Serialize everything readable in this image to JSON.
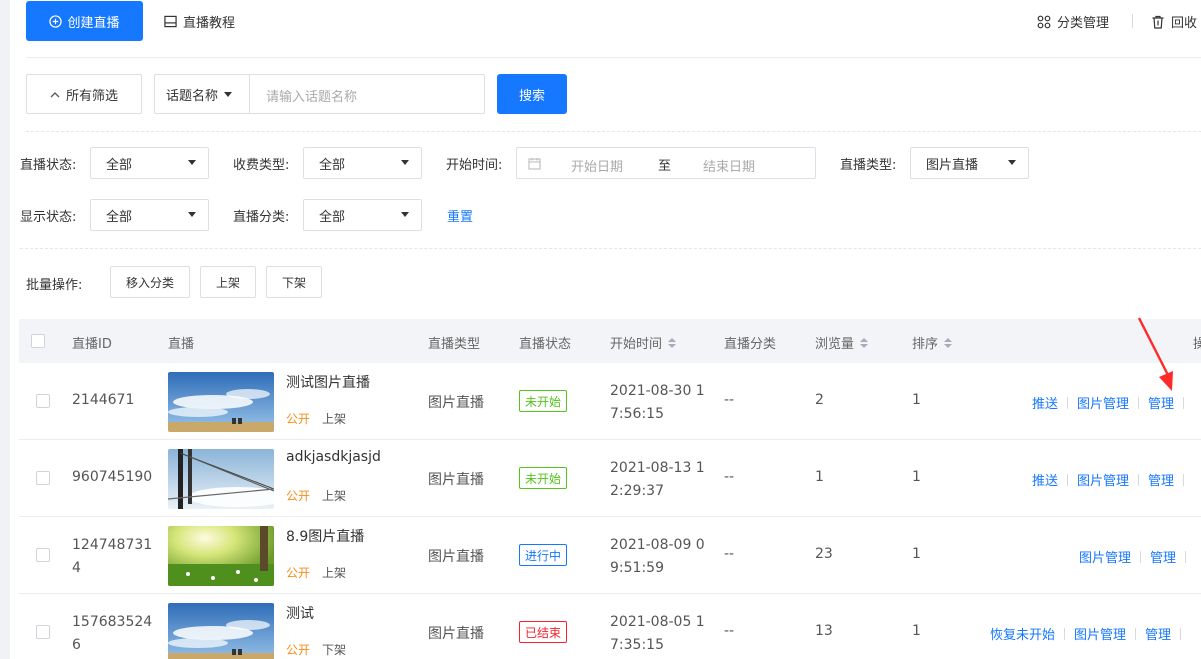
{
  "topbar": {
    "create_label": "创建直播",
    "tutorial_label": "直播教程",
    "category_label": "分类管理",
    "recycle_label": "回收"
  },
  "search": {
    "all_filters_label": "所有筛选",
    "field_label": "话题名称",
    "placeholder": "请输入话题名称",
    "search_label": "搜索"
  },
  "filters": {
    "status_label": "直播状态:",
    "status_value": "全部",
    "fee_label": "收费类型:",
    "fee_value": "全部",
    "start_label": "开始时间:",
    "start_placeholder": "开始日期",
    "to_label": "至",
    "end_placeholder": "结束日期",
    "type_label": "直播类型:",
    "type_value": "图片直播",
    "display_label": "显示状态:",
    "display_value": "全部",
    "category_label": "直播分类:",
    "category_value": "全部",
    "reset_label": "重置"
  },
  "batch": {
    "label": "批量操作:",
    "move_label": "移入分类",
    "up_label": "上架",
    "down_label": "下架"
  },
  "table": {
    "headers": {
      "id": "直播ID",
      "live": "直播",
      "type": "直播类型",
      "status": "直播状态",
      "start": "开始时间",
      "category": "直播分类",
      "views": "浏览量",
      "order": "排序",
      "ops": "操"
    },
    "rows": [
      {
        "id_line1": "2144671",
        "id_line2": "",
        "title": "测试图片直播",
        "visibility": "公开",
        "shelf": "上架",
        "type": "图片直播",
        "status": "未开始",
        "status_color": "#52c41a",
        "time_line1": "2021-08-30 1",
        "time_line2": "7:56:15",
        "category": "--",
        "views": "2",
        "order": "1",
        "op_push": "推送",
        "op_pics": "图片管理",
        "op_manage": "管理",
        "thumb": "sky-clouds"
      },
      {
        "id_line1": "960745190",
        "id_line2": "",
        "title": "adkjasdkjasjd",
        "visibility": "公开",
        "shelf": "上架",
        "type": "图片直播",
        "status": "未开始",
        "status_color": "#52c41a",
        "time_line1": "2021-08-13 1",
        "time_line2": "2:29:37",
        "category": "--",
        "views": "1",
        "order": "1",
        "op_push": "推送",
        "op_pics": "图片管理",
        "op_manage": "管理",
        "thumb": "bridge"
      },
      {
        "id_line1": "124748731",
        "id_line2": "4",
        "title": "8.9图片直播",
        "visibility": "公开",
        "shelf": "上架",
        "type": "图片直播",
        "status": "进行中",
        "status_color": "#1677ff",
        "time_line1": "2021-08-09 0",
        "time_line2": "9:51:59",
        "category": "--",
        "views": "23",
        "order": "1",
        "op_push": "",
        "op_pics": "图片管理",
        "op_manage": "管理",
        "thumb": "meadow"
      },
      {
        "id_line1": "157683524",
        "id_line2": "6",
        "title": "测试",
        "visibility": "公开",
        "shelf": "下架",
        "type": "图片直播",
        "status": "已结束",
        "status_color": "#f5222d",
        "time_line1": "2021-08-05 1",
        "time_line2": "7:35:15",
        "category": "--",
        "views": "13",
        "order": "1",
        "op_push": "恢复未开始",
        "op_pics": "图片管理",
        "op_manage": "管理",
        "thumb": "sky-clouds"
      }
    ]
  },
  "colors": {
    "primary": "#1677ff",
    "annotation_arrow": "#ff2a2a"
  }
}
